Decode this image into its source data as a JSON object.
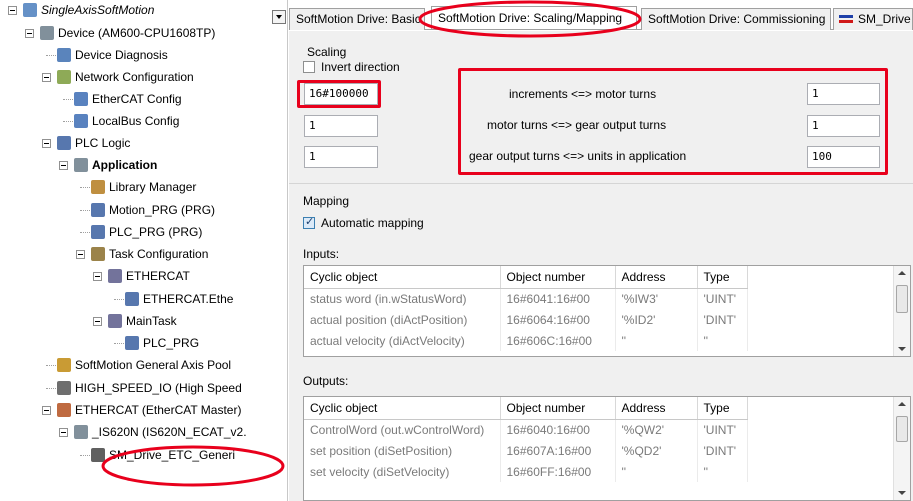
{
  "tree": {
    "nodes": [
      {
        "label": "SingleAxisSoftMotion",
        "icon": "project-icon",
        "italic": true
      },
      {
        "label": "Device (AM600-CPU1608TP)",
        "icon": "device-icon"
      },
      {
        "label": "Device Diagnosis",
        "icon": "diagnosis-icon"
      },
      {
        "label": "Network Configuration",
        "icon": "network-icon"
      },
      {
        "label": "EtherCAT Config",
        "icon": "ethercat-config-icon"
      },
      {
        "label": "LocalBus Config",
        "icon": "localbus-config-icon"
      },
      {
        "label": "PLC Logic",
        "icon": "plc-logic-icon"
      },
      {
        "label": "Application",
        "icon": "application-icon",
        "bold": true
      },
      {
        "label": "Library Manager",
        "icon": "library-icon"
      },
      {
        "label": "Motion_PRG (PRG)",
        "icon": "program-icon"
      },
      {
        "label": "PLC_PRG (PRG)",
        "icon": "program-icon"
      },
      {
        "label": "Task Configuration",
        "icon": "task-config-icon"
      },
      {
        "label": "ETHERCAT",
        "icon": "task-icon"
      },
      {
        "label": "ETHERCAT.Ethe",
        "icon": "call-icon"
      },
      {
        "label": "MainTask",
        "icon": "task-icon"
      },
      {
        "label": "PLC_PRG",
        "icon": "call-icon"
      },
      {
        "label": "SoftMotion General Axis Pool",
        "icon": "axis-pool-icon"
      },
      {
        "label": "HIGH_SPEED_IO (High Speed",
        "icon": "io-icon"
      },
      {
        "label": "ETHERCAT (EtherCAT Master)",
        "icon": "ethercat-master-icon"
      },
      {
        "label": "_IS620N (IS620N_ECAT_v2.",
        "icon": "slave-icon"
      },
      {
        "label": "SM_Drive_ETC_Generi",
        "icon": "drive-icon"
      }
    ]
  },
  "tabs": [
    {
      "label": "SoftMotion Drive: Basic"
    },
    {
      "label": "SoftMotion Drive: Scaling/Mapping"
    },
    {
      "label": "SoftMotion Drive: Commissioning"
    },
    {
      "label": "SM_Drive"
    }
  ],
  "scaling": {
    "title": "Scaling",
    "invert_label": "Invert direction",
    "rows": [
      {
        "left": "16#100000",
        "label": "increments <=> motor turns",
        "right": "1"
      },
      {
        "left": "1",
        "label": "motor turns <=> gear output turns",
        "right": "1"
      },
      {
        "left": "1",
        "label": "gear output turns <=> units in application",
        "right": "100"
      }
    ]
  },
  "mapping": {
    "title": "Mapping",
    "auto_label": "Automatic mapping",
    "auto_checked": true
  },
  "inputs": {
    "title": "Inputs:",
    "headers": [
      "Cyclic object",
      "Object number",
      "Address",
      "Type"
    ],
    "rows": [
      [
        "status word (in.wStatusWord)",
        "16#6041:16#00",
        "'%IW3'",
        "'UINT'"
      ],
      [
        "actual position (diActPosition)",
        "16#6064:16#00",
        "'%ID2'",
        "'DINT'"
      ],
      [
        "actual velocity (diActVelocity)",
        "16#606C:16#00",
        "''",
        "''"
      ]
    ]
  },
  "outputs": {
    "title": "Outputs:",
    "headers": [
      "Cyclic object",
      "Object number",
      "Address",
      "Type"
    ],
    "rows": [
      [
        "ControlWord (out.wControlWord)",
        "16#6040:16#00",
        "'%QW2'",
        "'UINT'"
      ],
      [
        "set position (diSetPosition)",
        "16#607A:16#00",
        "'%QD2'",
        "'DINT'"
      ],
      [
        "set velocity (diSetVelocity)",
        "16#60FF:16#00",
        "''",
        "''"
      ]
    ]
  },
  "colors": {
    "highlight": "#e8001c",
    "panel": "#f0f0f0"
  }
}
